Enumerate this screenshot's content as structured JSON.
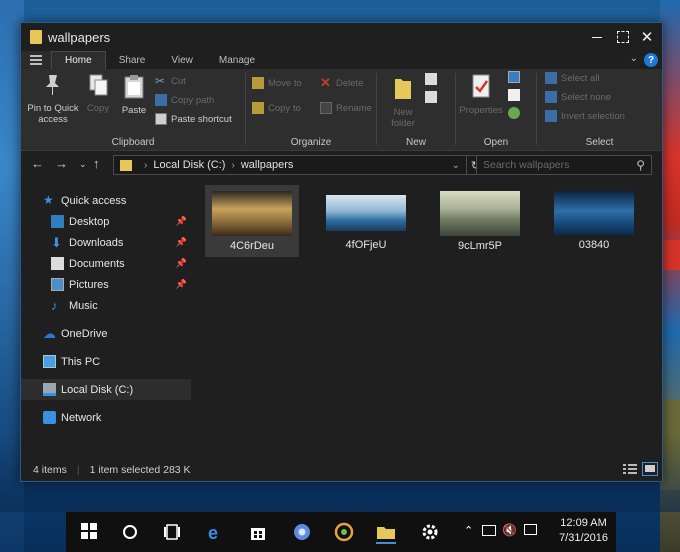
{
  "window": {
    "title": "wallpapers",
    "tabs": [
      "Home",
      "Share",
      "View",
      "Manage"
    ]
  },
  "ribbon": {
    "clipboard": {
      "pin": "Pin to Quick access",
      "copy": "Copy",
      "paste": "Paste",
      "cut": "Cut",
      "copy_path": "Copy path",
      "paste_shortcut": "Paste shortcut",
      "label": "Clipboard"
    },
    "organize": {
      "move_to": "Move to",
      "copy_to": "Copy to",
      "delete": "Delete",
      "rename": "Rename",
      "label": "Organize"
    },
    "new": {
      "new_folder": "New folder",
      "label": "New"
    },
    "open": {
      "properties": "Properties",
      "label": "Open"
    },
    "select": {
      "select_all": "Select all",
      "select_none": "Select none",
      "invert_selection": "Invert selection",
      "label": "Select"
    }
  },
  "address": {
    "path": [
      "Local Disk (C:)",
      "wallpapers"
    ],
    "search_placeholder": "Search wallpapers"
  },
  "navpane": {
    "quick_access": "Quick access",
    "desktop": "Desktop",
    "downloads": "Downloads",
    "documents": "Documents",
    "pictures": "Pictures",
    "music": "Music",
    "onedrive": "OneDrive",
    "this_pc": "This PC",
    "local_disk": "Local Disk (C:)",
    "network": "Network"
  },
  "files": [
    {
      "name": "4C6rDeu",
      "selected": true
    },
    {
      "name": "4fOFjeU",
      "selected": false
    },
    {
      "name": "9cLmr5P",
      "selected": false
    },
    {
      "name": "03840",
      "selected": false
    }
  ],
  "status": {
    "items": "4 items",
    "selected": "1 item selected  283 K"
  },
  "taskbar": {
    "time": "12:09 AM",
    "date": "7/31/2016"
  },
  "colors": {
    "window_bg": "#1f1f1f",
    "ribbon_bg": "#2e2e2e",
    "accent": "#1e78d6",
    "folder": "#e6c85a"
  }
}
